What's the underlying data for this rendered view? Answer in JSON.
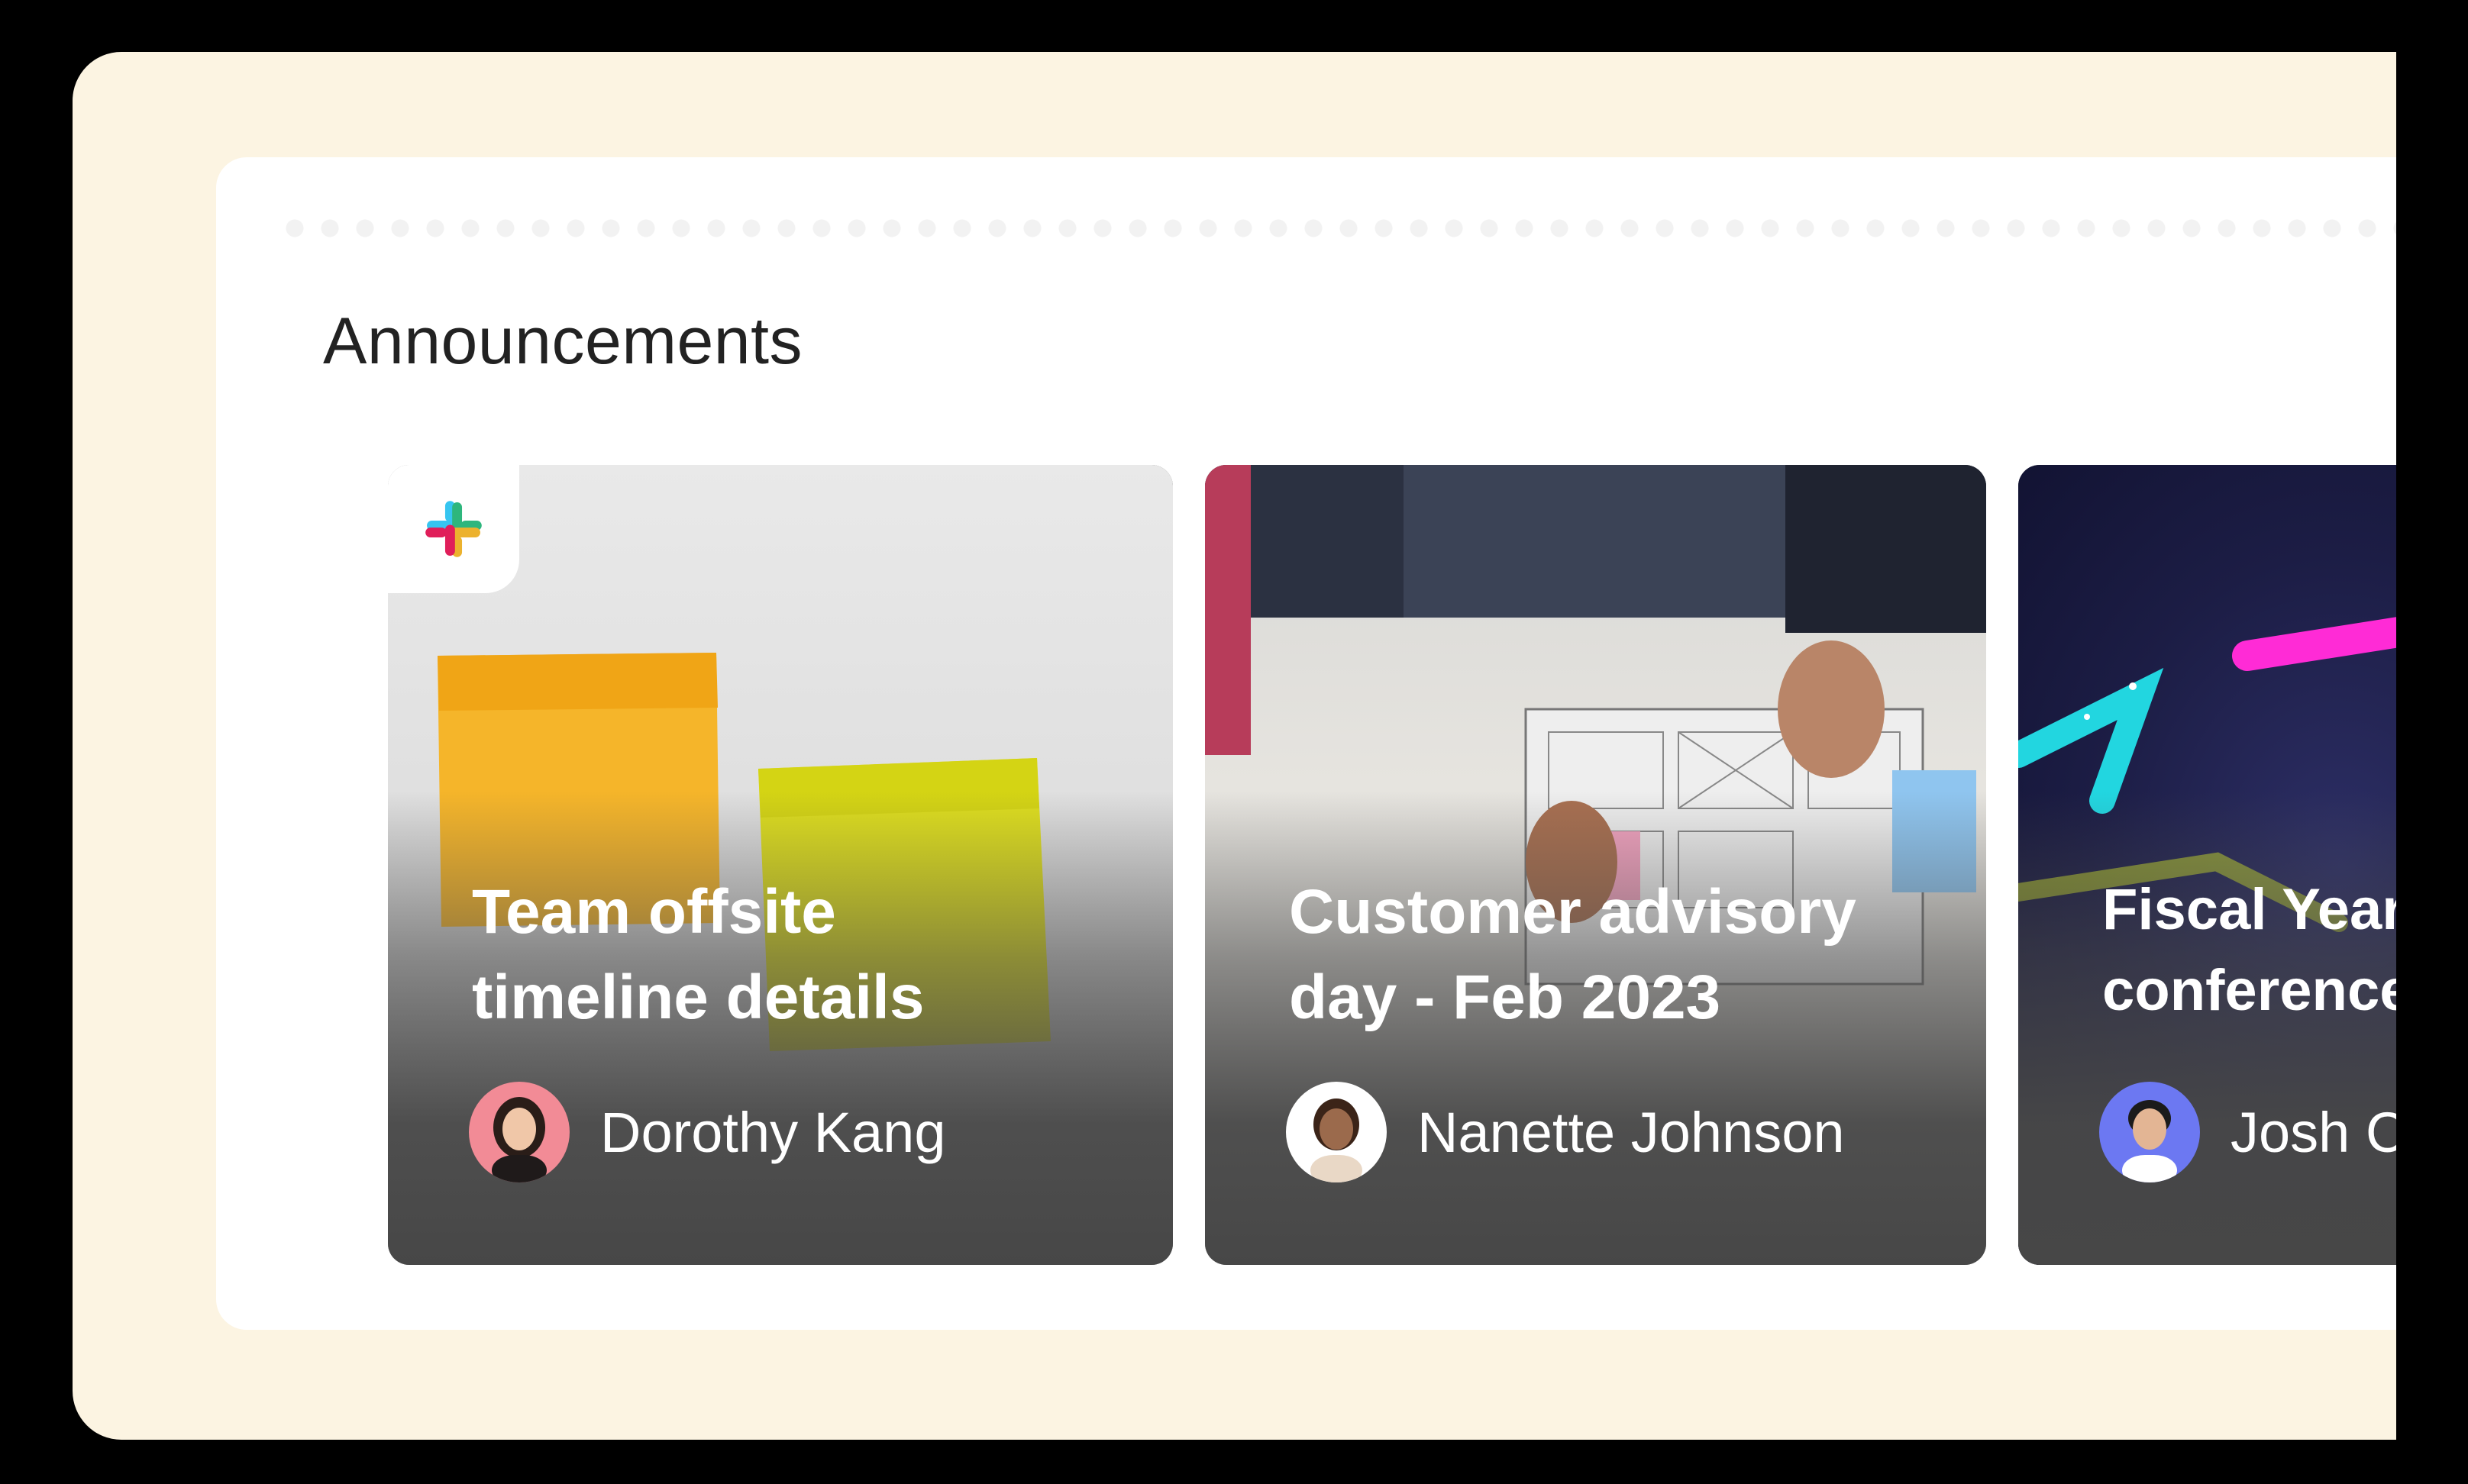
{
  "section": {
    "title": "Announcements"
  },
  "cards": [
    {
      "title_lines": [
        "Team offsite",
        "timeline details"
      ],
      "author": "Dorothy Kang",
      "badge_icon": "slack-logo-icon"
    },
    {
      "title_lines": [
        "Customer advisory",
        "day - Feb 2023"
      ],
      "author": "Nanette Johnson"
    },
    {
      "title_lines": [
        "Fiscal Year res",
        "conference"
      ],
      "author": "Josh Cha"
    }
  ],
  "colors": {
    "frame_background": "#fcf4e2",
    "panel_background": "#ffffff",
    "card_overlay": "#474747",
    "text_on_card": "#ffffff",
    "heading_text": "#222222"
  }
}
